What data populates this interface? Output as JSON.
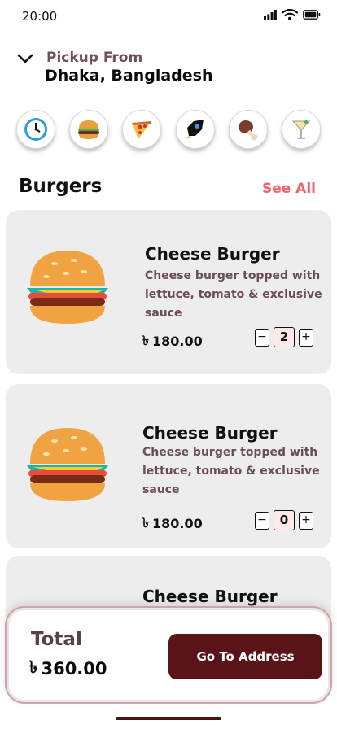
{
  "status_bar": {
    "time": "20:00",
    "icons": [
      "signal-icon",
      "wifi-icon",
      "battery-icon"
    ]
  },
  "location": {
    "label": "Pickup From",
    "value": "Dhaka, Bangladesh",
    "icon": "chevron-down-icon"
  },
  "categories": [
    {
      "icon": "clock-icon"
    },
    {
      "icon": "burger-icon"
    },
    {
      "icon": "pizza-icon"
    },
    {
      "icon": "rocket-icon"
    },
    {
      "icon": "meat-leg-icon"
    },
    {
      "icon": "cocktail-icon"
    }
  ],
  "section": {
    "title": "Burgers",
    "see_all": "See All"
  },
  "products": [
    {
      "name": "Cheese Burger",
      "description": "Cheese burger topped with lettuce, tomato & exclusive sauce",
      "currency": "৳",
      "price": "180.00",
      "quantity": "2"
    },
    {
      "name": "Cheese Burger",
      "description": "Cheese burger topped with lettuce, tomato & exclusive sauce",
      "currency": "৳",
      "price": "180.00",
      "quantity": "0"
    },
    {
      "name": "Cheese Burger"
    }
  ],
  "stepper": {
    "minus": "−",
    "plus": "+"
  },
  "footer": {
    "total_label": "Total",
    "currency": "৳",
    "total_value": "360.00",
    "button_label": "Go To Address"
  },
  "colors": {
    "accent": "#f0646e",
    "primary": "#5a1417",
    "card_bg": "#eeeded",
    "muted_text": "#6b4e51"
  }
}
